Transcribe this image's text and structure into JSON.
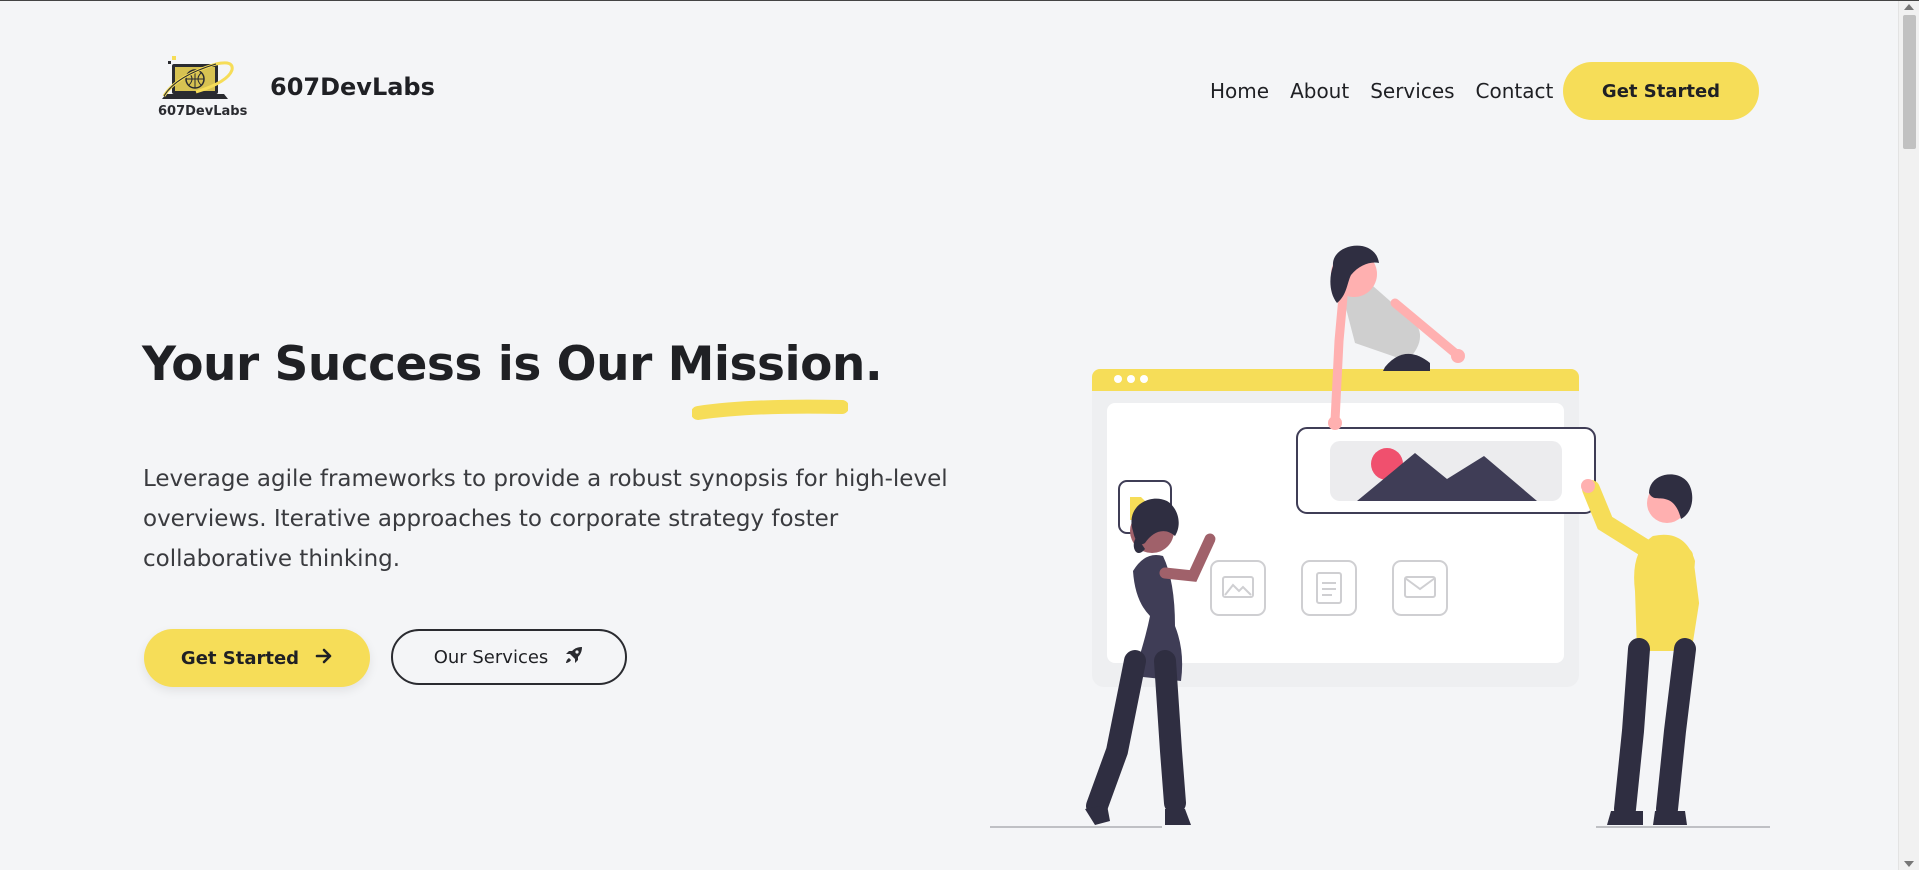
{
  "header": {
    "logo_text": "607DevLabs",
    "brand_name": "607DevLabs",
    "nav": [
      "Home",
      "About",
      "Services",
      "Contact"
    ],
    "cta_label": "Get Started"
  },
  "hero": {
    "title": "Your Success is Our Mission.",
    "description": "Leverage agile frameworks to provide a robust synopsis for high-level overviews. Iterative approaches to corporate strategy foster collaborative thinking.",
    "primary_button": "Get Started",
    "secondary_button": "Our Services"
  },
  "icons": {
    "primary_button_icon": "arrow-right-icon",
    "secondary_button_icon": "rocket-icon"
  },
  "colors": {
    "accent": "#f6dd58",
    "text": "#1f2024",
    "background": "#f4f5f7"
  }
}
